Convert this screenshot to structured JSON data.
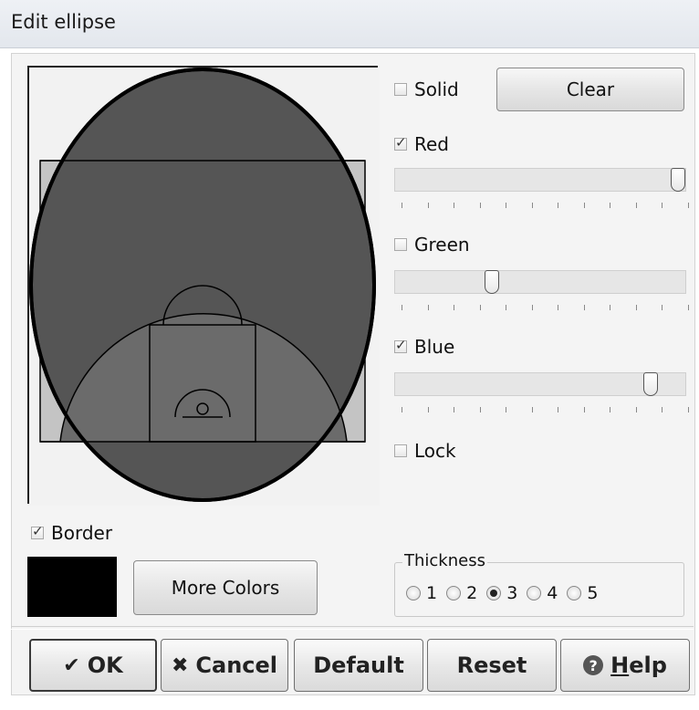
{
  "window": {
    "title": "Edit ellipse"
  },
  "controls": {
    "solid_label": "Solid",
    "clear_label": "Clear",
    "red_label": "Red",
    "green_label": "Green",
    "blue_label": "Blue",
    "lock_label": "Lock",
    "border_label": "Border",
    "more_colors_label": "More Colors",
    "solid_checked": false,
    "red_checked": true,
    "green_checked": false,
    "blue_checked": true,
    "lock_checked": false,
    "border_checked": true,
    "red_value": 1.0,
    "green_value": 0.34,
    "blue_value": 0.88
  },
  "thickness": {
    "legend": "Thickness",
    "options": [
      "1",
      "2",
      "3",
      "4",
      "5"
    ],
    "selected": "3"
  },
  "buttons": {
    "ok": "OK",
    "cancel": "Cancel",
    "default": "Default",
    "reset": "Reset",
    "help_prefix": "H",
    "help_rest": "elp"
  },
  "colors": {
    "swatch": "#000000",
    "ellipse_fill": "#555555",
    "court_fill": "#6b6b6b"
  },
  "icons": {
    "ok": "checkmark-icon",
    "cancel": "cross-icon",
    "help": "help-icon"
  }
}
